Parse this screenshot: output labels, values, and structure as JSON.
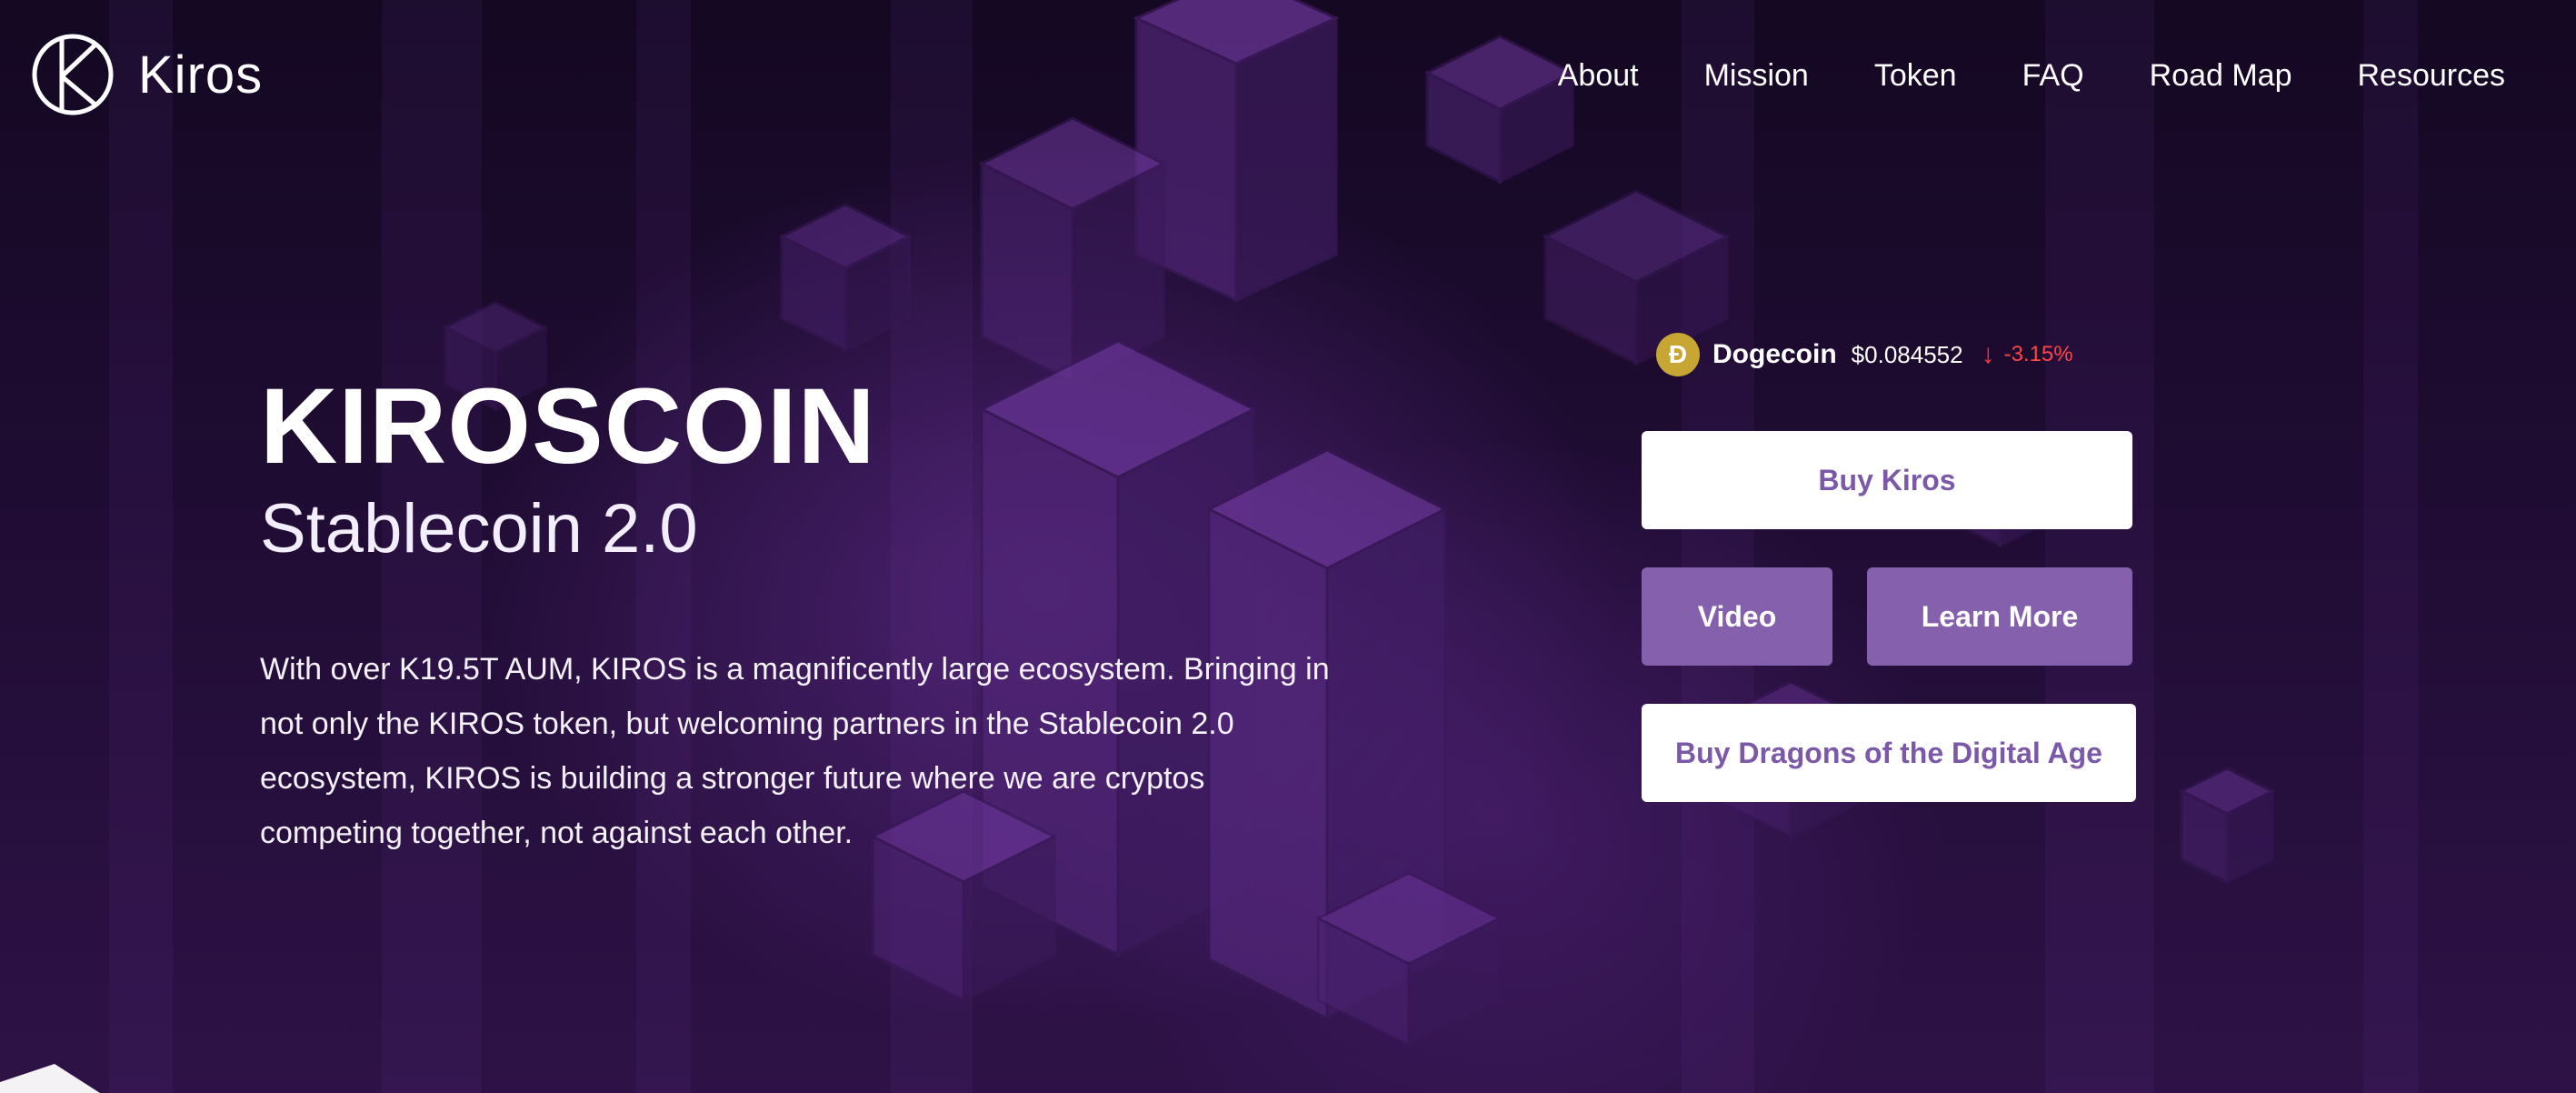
{
  "logo": {
    "text": "Kiros",
    "icon": "kiros-circle-logo-icon"
  },
  "nav": {
    "items": [
      "About",
      "Mission",
      "Token",
      "FAQ",
      "Road Map",
      "Resources"
    ]
  },
  "hero": {
    "title": "KIROSCOIN",
    "subtitle": "Stablecoin 2.0",
    "description": "With over K19.5T AUM, KIROS is a magnificently large ecosystem. Bringing in not only the KIROS token, but welcoming partners in the Stablecoin 2.0 ecosystem, KIROS is building a stronger future where we are cryptos competing together, not against each other."
  },
  "ticker": {
    "coin_symbol": "Đ",
    "coin_name": "Dogecoin",
    "price": "$0.084552",
    "change_arrow": "↓",
    "change": "-3.15%",
    "colors": {
      "coin": "#c8a634",
      "negative": "#ff4545"
    }
  },
  "buttons": {
    "buy_kiros": "Buy Kiros",
    "video": "Video",
    "learn_more": "Learn More",
    "buy_dragons": "Buy Dragons of the Digital Age"
  },
  "colors": {
    "accent": "#8460ad",
    "accent_text": "#7b58a8",
    "background": "#1f0c33"
  }
}
